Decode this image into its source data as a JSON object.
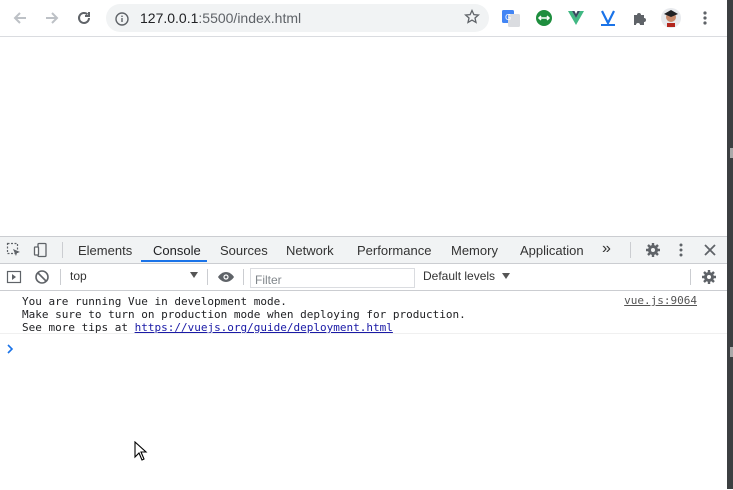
{
  "browser": {
    "url_host": "127.0.0.1",
    "url_path": ":5500/index.html"
  },
  "devtools": {
    "tabs": [
      "Elements",
      "Console",
      "Sources",
      "Network",
      "Performance",
      "Memory",
      "Application"
    ],
    "more_tabs": "»",
    "console_toolbar": {
      "context": "top",
      "filter_placeholder": "Filter",
      "levels": "Default levels"
    },
    "messages": [
      {
        "line1": "You are running Vue in development mode.",
        "line2": "Make sure to turn on production mode when deploying for production.",
        "line3_prefix": "See more tips at ",
        "line3_link": "https://vuejs.org/guide/deployment.html",
        "source": "vue.js:9064"
      }
    ],
    "prompt_symbol": "›"
  },
  "colors": {
    "accent": "#1a73e8",
    "toolbar_bg": "#ffffff",
    "omnibox_bg": "#f1f3f4",
    "devtools_tabbar_bg": "#f1f3f4"
  }
}
